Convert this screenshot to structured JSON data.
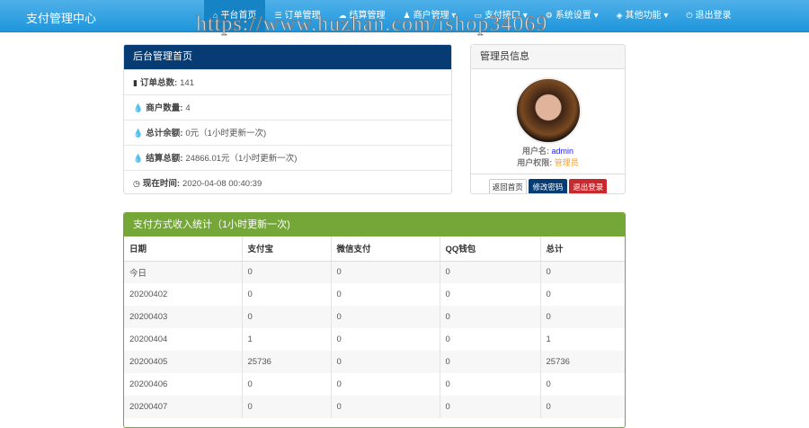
{
  "navbar": {
    "brand": "支付管理中心",
    "items": [
      {
        "label": "平台首页",
        "icon": "home-icon",
        "glyph": "⌂",
        "active": true
      },
      {
        "label": "订单管理",
        "icon": "list-icon",
        "glyph": "☰"
      },
      {
        "label": "结算管理",
        "icon": "cloud-icon",
        "glyph": "☁"
      },
      {
        "label": "商户管理 ▾",
        "icon": "user-icon",
        "glyph": "♟"
      },
      {
        "label": "支付接口 ▾",
        "icon": "card-icon",
        "glyph": "▭"
      },
      {
        "label": "系统设置 ▾",
        "icon": "gear-icon",
        "glyph": "⚙"
      },
      {
        "label": "其他功能 ▾",
        "icon": "cube-icon",
        "glyph": "◈"
      },
      {
        "label": "退出登录",
        "icon": "power-icon",
        "glyph": "⏻"
      }
    ]
  },
  "watermark": "https://www.huzhan.com/ishop34069",
  "overview": {
    "title": "后台管理首页",
    "rows": [
      {
        "icon": "bar-chart-icon",
        "glyph": "▮",
        "label": "订单总数:",
        "value": "141"
      },
      {
        "icon": "drop-icon",
        "glyph": "💧",
        "label": "商户数量:",
        "value": "4"
      },
      {
        "icon": "drop-icon",
        "glyph": "💧",
        "label": "总计余额:",
        "value": "0元（1小时更新一次)"
      },
      {
        "icon": "drop-icon",
        "glyph": "💧",
        "label": "结算总额:",
        "value": "24866.01元（1小时更新一次)"
      },
      {
        "icon": "clock-icon",
        "glyph": "◷",
        "label": "现在时间:",
        "value": "2020-04-08 00:40:39"
      }
    ]
  },
  "admin": {
    "title": "管理员信息",
    "username_label": "用户名:",
    "username": "admin",
    "role_label": "用户权限:",
    "role": "管理员",
    "buttons": [
      "返回首页",
      "修改密码",
      "退出登录"
    ]
  },
  "stats": {
    "title": "支付方式收入统计（1小时更新一次)",
    "headers": [
      "日期",
      "支付宝",
      "微信支付",
      "QQ钱包",
      "总计"
    ],
    "rows": [
      [
        "今日",
        "0",
        "0",
        "0",
        "0"
      ],
      [
        "20200402",
        "0",
        "0",
        "0",
        "0"
      ],
      [
        "20200403",
        "0",
        "0",
        "0",
        "0"
      ],
      [
        "20200404",
        "1",
        "0",
        "0",
        "1"
      ],
      [
        "20200405",
        "25736",
        "0",
        "0",
        "25736"
      ],
      [
        "20200406",
        "0",
        "0",
        "0",
        "0"
      ],
      [
        "20200407",
        "0",
        "0",
        "0",
        "0"
      ]
    ]
  }
}
